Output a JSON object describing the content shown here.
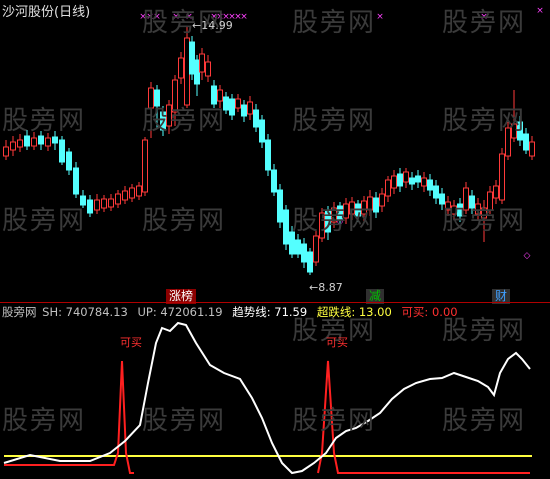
{
  "window": {
    "title": "沙河股份(日线)"
  },
  "watermark": "股旁网",
  "price_panel": {
    "high_label": "14.99",
    "low_label": "8.87",
    "badges": [
      {
        "text": "涨榜",
        "color": "#ffffff",
        "bg": "#8b0000"
      },
      {
        "text": "减",
        "color": "#00c000",
        "bg": "#303030"
      },
      {
        "text": "财",
        "color": "#40a0ff",
        "bg": "#303030"
      }
    ],
    "colors": {
      "up": "#ff3a3a",
      "down": "#54ffff",
      "ma": "#ffffff",
      "signal": "#ff40ff"
    }
  },
  "indicator_panel": {
    "name": "股旁网",
    "items": [
      {
        "text": "SH: 740784.13",
        "color": "#c0c0c0"
      },
      {
        "text": "UP: 472061.19",
        "color": "#c0c0c0"
      },
      {
        "text": "趋势线: 71.59",
        "color": "#ffffff"
      },
      {
        "text": "超跌线: 13.00",
        "color": "#ffff40"
      },
      {
        "text": "可买: 0.00",
        "color": "#ff3030"
      }
    ],
    "buy_label": "可买"
  },
  "chart_data": {
    "type": "candlestick",
    "title": "沙河股份(日线)",
    "annotations": [
      {
        "label": "14.99",
        "kind": "period-high"
      },
      {
        "label": "8.87",
        "kind": "period-low"
      }
    ],
    "indicator": {
      "name": "股旁网",
      "SH": 740784.13,
      "UP": 472061.19,
      "trend_line_last": 71.59,
      "oversold_line": 13.0,
      "buy_signal_last": 0.0,
      "buy_signals_marked": 2
    }
  }
}
